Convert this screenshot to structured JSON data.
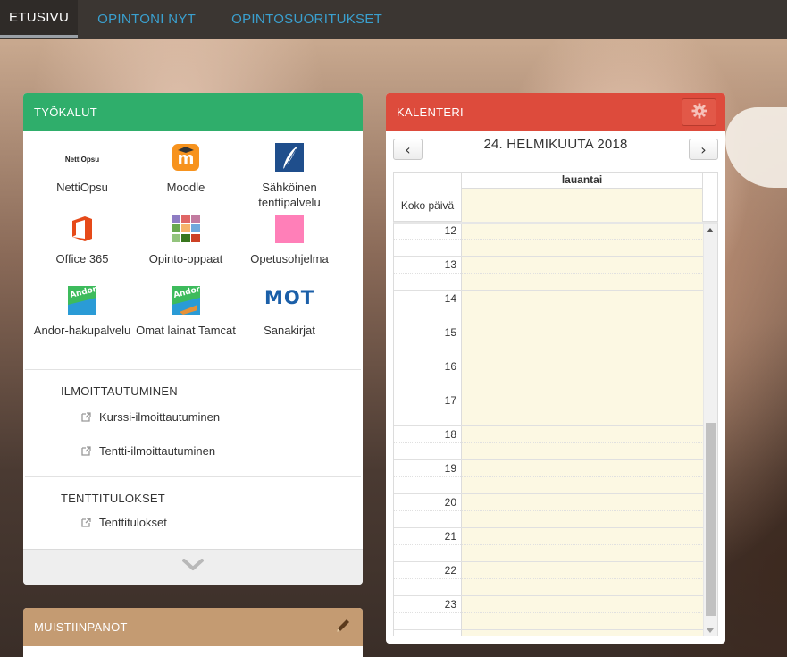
{
  "nav": {
    "tabs": [
      {
        "label": "ETUSIVU",
        "active": true
      },
      {
        "label": "OPINTONI NYT",
        "active": false
      },
      {
        "label": "OPINTOSUORITUKSET",
        "active": false
      }
    ]
  },
  "tools": {
    "title": "TYÖKALUT",
    "items": [
      {
        "label": "NettiOpsu",
        "icon": "nettiopsu-logo-icon",
        "logo_text": "NettiOpsu"
      },
      {
        "label": "Moodle",
        "icon": "moodle-icon"
      },
      {
        "label": "Sähköinen tenttipalvelu",
        "icon": "exam-service-icon"
      },
      {
        "label": "Office 365",
        "icon": "office365-icon"
      },
      {
        "label": "Opinto-oppaat",
        "icon": "study-guides-icon"
      },
      {
        "label": "Opetusohjelma",
        "icon": "timetable-icon"
      },
      {
        "label": "Andor-hakupalvelu",
        "icon": "andor-icon",
        "logo_text": "Andor"
      },
      {
        "label": "Omat lainat Tamcat",
        "icon": "andor-loans-icon",
        "logo_text": "Andor"
      },
      {
        "label": "Sanakirjat",
        "icon": "mot-dictionary-icon",
        "logo_text": "MOT"
      }
    ],
    "sections": [
      {
        "title": "ILMOITTAUTUMINEN",
        "links": [
          "Kurssi-ilmoittautuminen",
          "Tentti-ilmoittautuminen"
        ]
      },
      {
        "title": "TENTTITULOKSET",
        "links": [
          "Tenttitulokset"
        ]
      }
    ],
    "expand_icon": "chevron-down-icon"
  },
  "notes": {
    "title": "MUISTIINPANOT",
    "edit_icon": "pencil-icon"
  },
  "calendar": {
    "title": "KALENTERI",
    "settings_icon": "gear-icon",
    "date": "24. HELMIKUUTA 2018",
    "prev": "‹",
    "next": "›",
    "day_name": "lauantai",
    "all_day_label": "Koko päivä",
    "hours": [
      "12",
      "13",
      "14",
      "15",
      "16",
      "17",
      "18",
      "19",
      "20",
      "21",
      "22",
      "23"
    ]
  },
  "colors": {
    "tools_header": "#2fae6b",
    "calendar_header": "#dd4b3c",
    "notes_header": "#c49b72",
    "nav_active": "#ffffff",
    "nav_link": "#3aa0cf",
    "day_cell": "#fcf8e3"
  }
}
